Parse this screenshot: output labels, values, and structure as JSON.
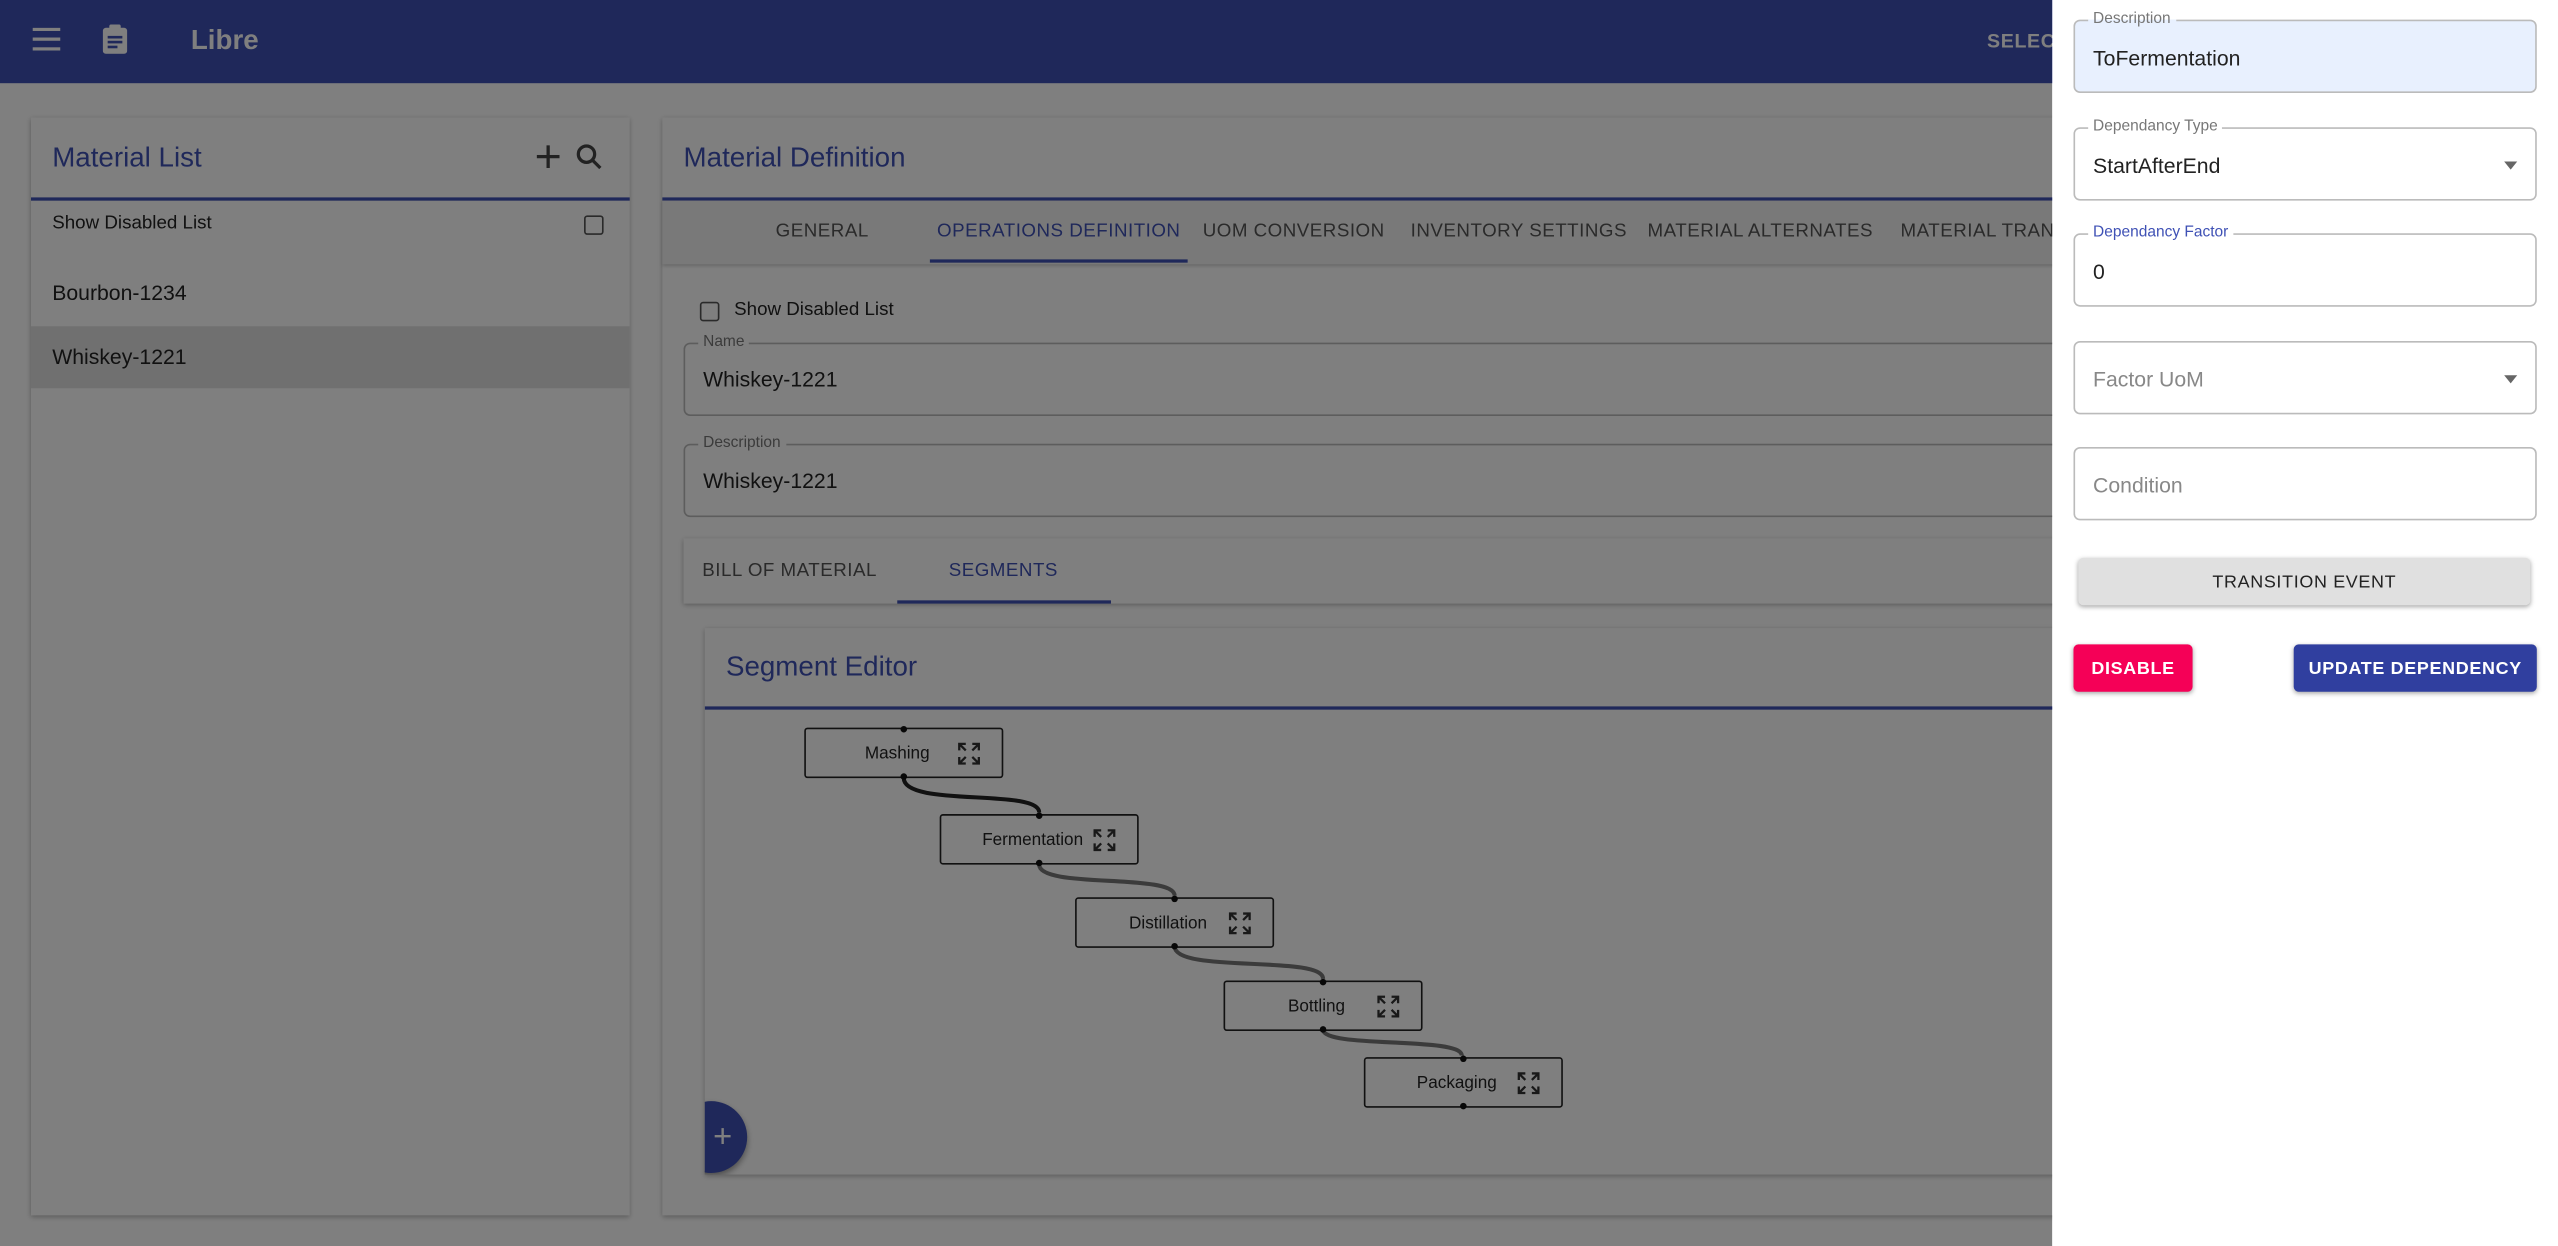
{
  "app": {
    "title": "Libre",
    "select_label": "SELECT",
    "menu_icon": "menu-icon",
    "logo_icon": "clipboard-icon"
  },
  "material_list": {
    "title": "Material List",
    "show_disabled_label": "Show Disabled List",
    "items": [
      {
        "label": "Bourbon-1234",
        "selected": false
      },
      {
        "label": "Whiskey-1221",
        "selected": true
      }
    ]
  },
  "material_definition": {
    "title": "Material Definition",
    "tabs": [
      {
        "label": "GENERAL",
        "active": false
      },
      {
        "label": "OPERATIONS DEFINITION",
        "active": true
      },
      {
        "label": "UOM CONVERSION",
        "active": false
      },
      {
        "label": "INVENTORY SETTINGS",
        "active": false
      },
      {
        "label": "MATERIAL ALTERNATES",
        "active": false
      },
      {
        "label": "MATERIAL TRANS",
        "active": false
      }
    ],
    "show_disabled_label": "Show Disabled List",
    "name": {
      "label": "Name",
      "value": "Whiskey-1221"
    },
    "description": {
      "label": "Description",
      "value": "Whiskey-1221"
    },
    "sub_tabs": [
      {
        "label": "BILL OF MATERIAL",
        "active": false
      },
      {
        "label": "SEGMENTS",
        "active": true
      }
    ],
    "segment_editor": {
      "title": "Segment Editor",
      "nodes": [
        "Mashing",
        "Fermentation",
        "Distillation",
        "Bottling",
        "Packaging"
      ],
      "add_label": "+"
    }
  },
  "drawer": {
    "description": {
      "label": "Description",
      "value": "ToFermentation"
    },
    "dependancy_type": {
      "label": "Dependancy Type",
      "value": "StartAfterEnd"
    },
    "dependancy_factor": {
      "label": "Dependancy Factor",
      "value": "0"
    },
    "factor_uom": {
      "placeholder": "Factor UoM"
    },
    "condition": {
      "placeholder": "Condition"
    },
    "transition_event_label": "TRANSITION EVENT",
    "disable_label": "DISABLE",
    "update_label": "UPDATE DEPENDENCY"
  },
  "colors": {
    "primary": "#3f51b5",
    "accent": "#f50057",
    "update_button": "#303f9f",
    "autofill_bg": "#e8f0fe"
  }
}
